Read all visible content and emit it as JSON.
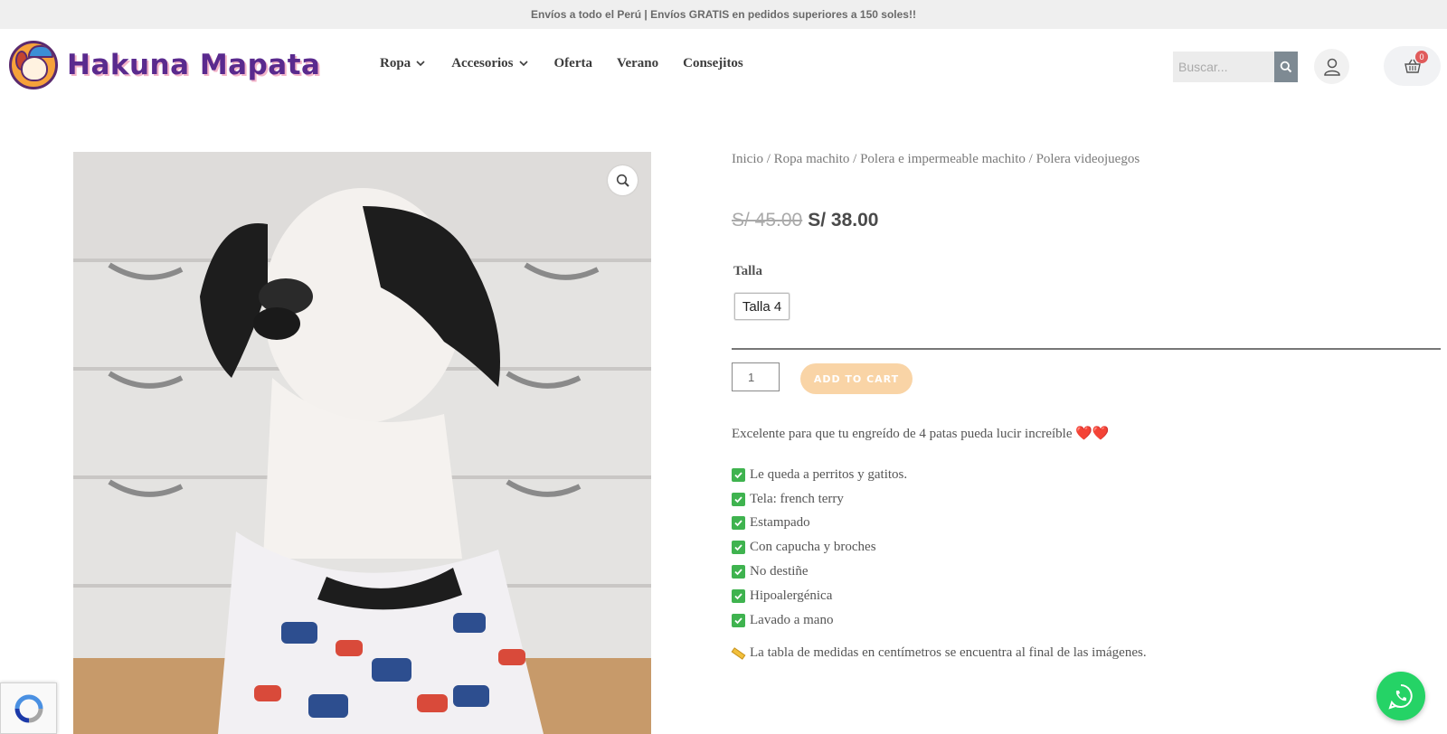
{
  "topbar": {
    "text": "Envíos a todo el Perú | Envíos GRATIS en pedidos superiores a 150 soles!!"
  },
  "header": {
    "logo_text": "Hakuna Mapata",
    "nav": [
      {
        "label": "Ropa",
        "has_dropdown": true
      },
      {
        "label": "Accesorios",
        "has_dropdown": true
      },
      {
        "label": "Oferta",
        "has_dropdown": false
      },
      {
        "label": "Verano",
        "has_dropdown": false
      },
      {
        "label": "Consejitos",
        "has_dropdown": false
      }
    ],
    "search": {
      "placeholder": "Buscar..."
    },
    "cart": {
      "count": "0"
    }
  },
  "product": {
    "breadcrumb": [
      "Inicio",
      "Ropa machito",
      "Polera e impermeable machito",
      "Polera videojuegos"
    ],
    "breadcrumb_sep": " / ",
    "price_old": "S/ 45.00",
    "price_new": "S/ 38.00",
    "talla_label": "Talla",
    "talla_option": "Talla 4",
    "quantity": "1",
    "add_to_cart": "ADD TO CART",
    "description": "Excelente para que tu engreído de 4 patas pueda lucir increíble",
    "description_emoji": "❤️❤️",
    "features": [
      "Le queda a perritos y gatitos.",
      "Tela: french terry",
      "Estampado",
      "Con capucha y broches",
      "No destiñe",
      "Hipoalergénica",
      "Lavado a mano"
    ],
    "note": "La tabla de medidas en centímetros se encuentra al final de las imágenes."
  },
  "colors": {
    "brand_purple": "#5a2a8e",
    "add_to_cart_bg": "#f9d4a6",
    "whatsapp_green": "#25d366",
    "cart_badge": "#e05b5b"
  }
}
